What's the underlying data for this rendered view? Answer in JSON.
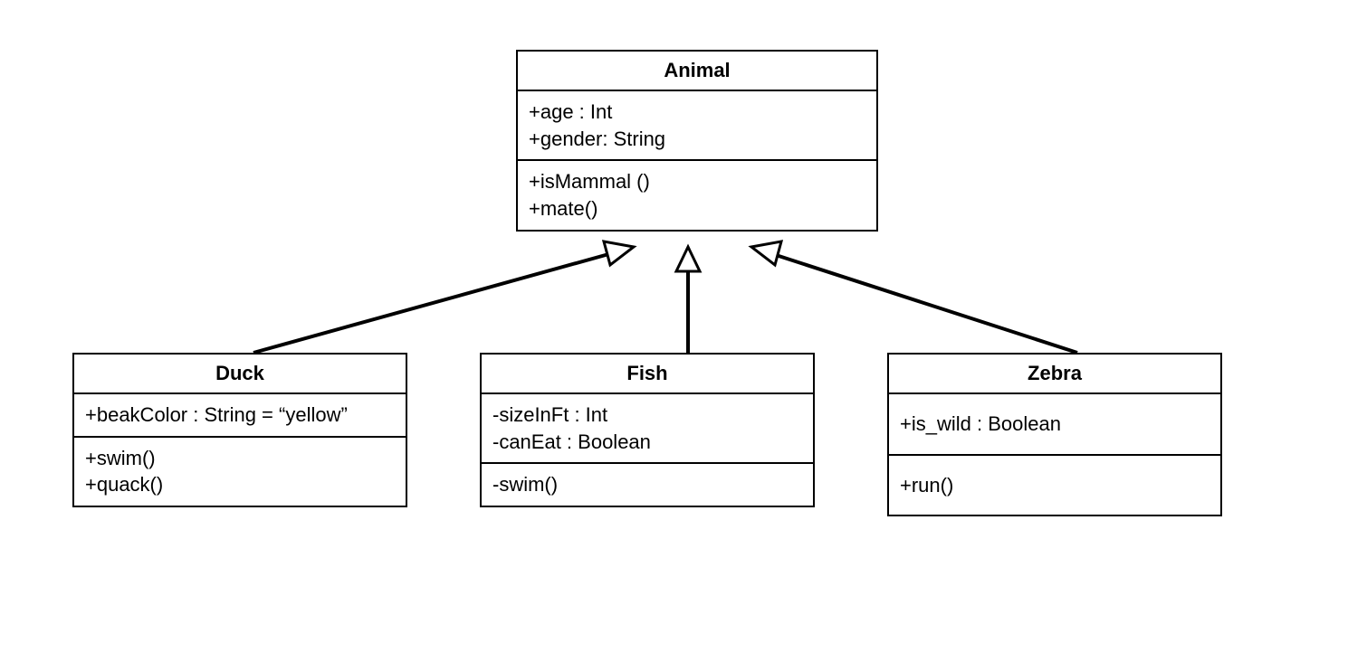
{
  "diagram": {
    "type": "uml-class-diagram",
    "relationships": [
      {
        "from": "Duck",
        "to": "Animal",
        "kind": "inheritance"
      },
      {
        "from": "Fish",
        "to": "Animal",
        "kind": "inheritance"
      },
      {
        "from": "Zebra",
        "to": "Animal",
        "kind": "inheritance"
      }
    ],
    "classes": {
      "animal": {
        "name": "Animal",
        "attrs": [
          "+age : Int",
          "+gender: String"
        ],
        "ops": [
          "+isMammal ()",
          "+mate()"
        ]
      },
      "duck": {
        "name": "Duck",
        "attrs": [
          "+beakColor : String = “yellow”"
        ],
        "ops": [
          "+swim()",
          "+quack()"
        ]
      },
      "fish": {
        "name": "Fish",
        "attrs": [
          "-sizeInFt : Int",
          "-canEat : Boolean"
        ],
        "ops": [
          "-swim()"
        ]
      },
      "zebra": {
        "name": "Zebra",
        "attrs": [
          "+is_wild : Boolean"
        ],
        "ops": [
          "+run()"
        ]
      }
    }
  }
}
